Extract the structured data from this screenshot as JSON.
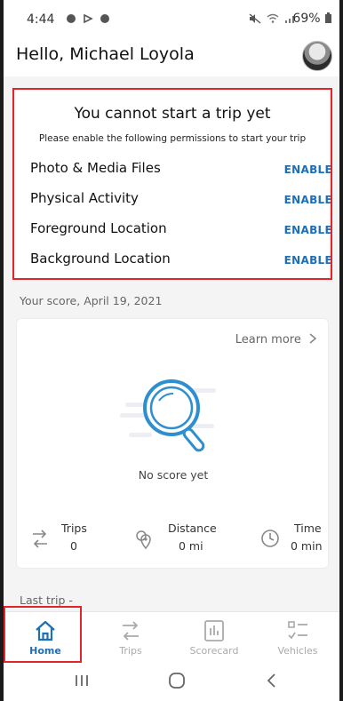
{
  "status_bar": {
    "time": "4:44",
    "battery": "69%"
  },
  "header": {
    "greeting": "Hello, Michael Loyola"
  },
  "permissions": {
    "title": "You cannot start a trip yet",
    "subtitle": "Please enable the following permissions to start your trip",
    "items": [
      {
        "label": "Photo & Media Files",
        "action": "ENABLE"
      },
      {
        "label": "Physical Activity",
        "action": "ENABLE"
      },
      {
        "label": "Foreground Location",
        "action": "ENABLE"
      },
      {
        "label": "Background Location",
        "action": "ENABLE"
      }
    ]
  },
  "score": {
    "title": "Your score, April 19, 2021",
    "learn_more": "Learn more",
    "empty_text": "No score yet",
    "stats": [
      {
        "label": "Trips",
        "value": "0"
      },
      {
        "label": "Distance",
        "value": "0 mi"
      },
      {
        "label": "Time",
        "value": "0 min"
      }
    ]
  },
  "last_trip": {
    "title": "Last trip -"
  },
  "bottom_nav": {
    "items": [
      {
        "label": "Home"
      },
      {
        "label": "Trips"
      },
      {
        "label": "Scorecard"
      },
      {
        "label": "Vehicles"
      }
    ],
    "active": "Home"
  },
  "colors": {
    "accent": "#1d6fb8",
    "highlight": "#e0262b",
    "magnifier": "#2e8fd0"
  }
}
